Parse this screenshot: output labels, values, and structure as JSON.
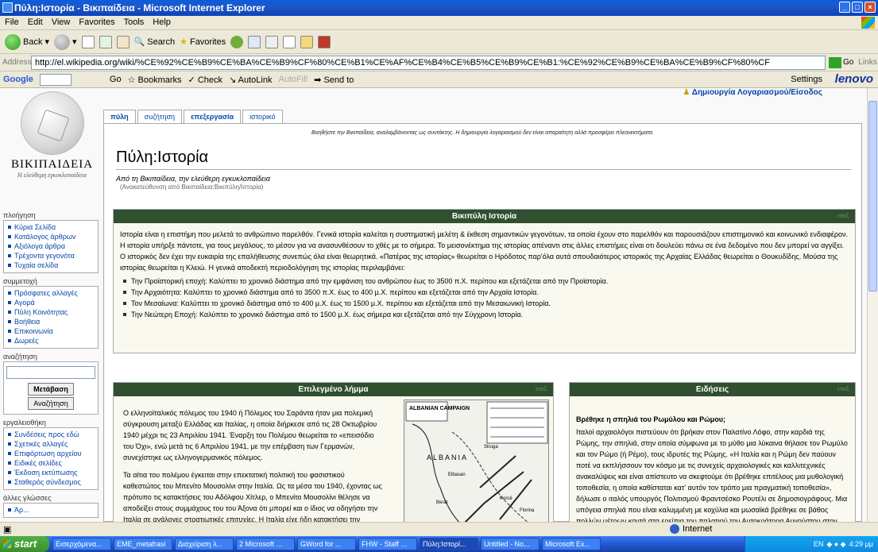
{
  "window": {
    "title": "Πύλη:Ιστορία - Βικιπαίδεια - Microsoft Internet Explorer"
  },
  "menu": [
    "File",
    "Edit",
    "View",
    "Favorites",
    "Tools",
    "Help"
  ],
  "toolbar": {
    "back": "Back",
    "search": "Search",
    "favorites": "Favorites"
  },
  "address": {
    "label": "Address",
    "url": "http://el.wikipedia.org/wiki/%CE%92%CE%B9%CE%BA%CE%B9%CF%80%CE%B1%CE%AF%CE%B4%CE%B5%CE%B9%CE%B1:%CE%92%CE%B9%CE%BA%CE%B9%CF%80%CF",
    "go": "Go",
    "links": "Links"
  },
  "googlebar": {
    "brand": "Google",
    "go": "Go",
    "bookmarks": "Bookmarks",
    "check": "Check",
    "autolink": "AutoLink",
    "autofill": "AutoFill",
    "sendto": "Send to",
    "settings": "Settings",
    "oem": "lenovo"
  },
  "wiki": {
    "logo_title": "ΒΙΚΙΠΑΙΔΕΙΑ",
    "logo_sub": "Η ελεύθερη εγκυκλοπαίδεια",
    "login": "Δημιουργία Λογαριασμού/Είσοδος",
    "tabs": [
      "πύλη",
      "συζήτηση",
      "επεξεργασία",
      "ιστορικό"
    ],
    "sitenotice": "Βοηθήστε την Βικιπαίδεια, αναλαμβάνοντας ως συντάκτης. Η δημιουργία λογαριασμού δεν είναι απαραίτητη αλλά προσφέρει πλεονεκτήματα.",
    "page_title": "Πύλη:Ιστορία",
    "tagline": "Από τη Βικιπαίδεια, την ελεύθερη εγκυκλοπαίδεια",
    "redirect": "(Ανακατεύθυνση από Βικιπαίδεια:Βικιπύλη/Ιστορία)",
    "panel1_title": "Βικιπύλη Ιστορία",
    "edit": "επεξ.",
    "panel1_text": "Ιστορία είναι η επιστήμη που μελετά το ανθρώπινο παρελθόν. Γενικά ιστορία καλείται η συστηματική μελέτη & έκθεση σημαντικών γεγονότων, τα οποία έχουν στο παρελθόν και παρουσιάζουν επιστημονικό και κοινωνικό ενδιαφέρον. Η ιστορία υπήρξε πάντοτε, για τους μεγάλους, το μέσον για να ανασυνθέσουν το χθές με το σήμερα. Το μεισονέκτημα της ιστορίας απέναντι στις άλλες επιστήμες είναι οτι δουλεύει πάνω σε ένα δεδομένο που δεν μπορεί να αγγίξει. Ο ιστορικός δεν έχει την ευκαιρία της επαλήθευσης συνεπώς όλα είναι θεωρητικά. «Πατέρας της ιστορίας» θεωρείται ο Ηρόδοτος παρ'όλα αυτά σπουδαιότερος ιστορικός της Αρχαίας Ελλάδας θεωρείται ο Θουκυδίδης. Μούσα της ιστορίας θεωρείται η Κλειώ. Η γενικά αποδεκτή περιοδολόγηση της ιστορίας περιλαμβάνει:",
    "periods": [
      "Την Προϊστορική εποχή: Καλύπτει το χρονικό διάστημα από την εμφάνιση του ανθρώπου έως το 3500 π.Χ. περίπου και εξετάζεται από την Προϊστορία.",
      "Την Αρχαιότητα: Καλύπτει το χρονικό διάστημα από το 3500 π.Χ. έως το 400 μ.Χ. περίπου και εξετάζεται από την Αρχαία Ιστορία.",
      "Τον Μεσαίωνα: Καλύπτει το χρονικό διάστημα από το 400 μ.Χ. έως το 1500 μ.Χ. περίπου και εξετάζεται από την Μεσαιωνική Ιστορία.",
      "Την Νεώτερη Εποχή: Καλύπτει το χρονικό διάστημα από το 1500 μ.Χ. έως σήμερα και εξετάζεται από την Σύγχρονη Ιστορία."
    ],
    "panel2_title": "Επιλεγμένο λήμμα",
    "panel2_p1": "Ο ελληνοϊταλικός πόλεμος του 1940 ή Πόλεμος του Σαράντα ήταν μια πολεμική σύγκρουση μεταξύ Ελλάδας και Ιταλίας, η οποία διήρκεσε από τις 28 Οκτωβρίου 1940 μέχρι τις 23 Απριλίου 1941. Έναρξη του Πολέμου θεωρείται το «επεισόδιο του Όχι», ενώ μετά τις 6 Απριλίου 1941, με την επέμβαση των Γερμανών, συνεχίστηκε ως ελληνογερμανικός πόλεμος.",
    "panel2_p2": "Τα αίτια του πολέμου έγκειται στην επεκτατική πολιτική του φασιστικού καθεστώτος του Μπενίτο Μουσολίνι στην Ιταλία. Ως τα μέσα του 1940, έχοντας ως πρότυπο τις κατακτήσεις του Αδόλφου Χίτλερ, ο Μπενίτο Μουσολίνι θέλησε να αποδείξει στους συμμάχους του του Άξονα ότι μπορεί και ο ίδιος να οδηγήσει την Ιταλία σε ανάλογες στρατιωτικές επιτυχίες. Η Ιταλία είχε ήδη κατακτήσει την Αλβανία από την άνοιξη του 1939, καθώς και πολλές βρετανικές βάσεις στην Αφρική, όπως τη Σομαλιλάνδη το καλοκαίρι του 1940, αλλά αυτές δεν ήταν επιτυχίες",
    "map_title": "ALBANIAN CAMPAIGN",
    "map_label": "ALBANIA",
    "map_places": [
      "Elbasan",
      "Korcë",
      "Berat",
      "Florina",
      "Struga"
    ],
    "panel3_title": "Ειδήσεις",
    "news_title": "Βρέθηκε η σπηλιά του Ρωμύλου και Ρώμου;",
    "news_text": "Ιταλοί αρχαιολόγοι πιστεύουν ότι βρήκαν στον Παλατίνο Λόφο, στην καρδιά της Ρώμης, την σπηλιά, στην οποία σύμφωνα με το μύθο μια λύκαινα θήλασε τον Ρωμύλο και τον Ρώμο (ή Ρέμο), τους ιδρυτές της Ρώμης. «Η Ιταλία και η Ρώμη δεν παύουν ποτέ να εκπλήσσουν τον κόσμο με τις συνεχείς αρχαιολογικές και καλλιτεχνικές ανακαλύψεις και είναι απίστευτο να σκεφτούμε ότι βρέθηκε επιτέλους μια μυθολογική τοποθεσία, η οποία καθίσταται κατ' αυτόν τον τρόπο μια πραγματική τοποθεσία», δήλωσε ο ιταλός υπουργός Πολιτισμού Φραντσέσκο Ρουτέλι σε δημοσιογράφους. Μια υπόγεια σπηλιά που είναι καλυμμένη με κοχύλια και μωσαϊκά βρέθηκε σε βάθος πολλών μέτρων κοντά στα ερείπια του παλατιού του Αυτοκράτορα Αυγούστου στον Παλατίνο Λόφο. Η σπηλιά, η οποία βρέθηκε στη διάρκεια εργασιών αποκατάστασης, έχει διάμετρο 6,5 μέτρων και ύψος 7 μέτρων. Σύμφωνα με το",
    "sidebar": {
      "nav_h": "πλοήγηση",
      "nav": [
        "Κύρια Σελίδα",
        "Κατάλογος άρθρων",
        "Αξιόλογα άρθρα",
        "Τρέχοντα γεγονότα",
        "Τυχαία σελίδα"
      ],
      "comm_h": "συμμετοχή",
      "comm": [
        "Πρόσφατες αλλαγές",
        "Αγορά",
        "Πύλη Κοινότητας",
        "Βοήθεια",
        "Επικοινωνία",
        "Δωρεές"
      ],
      "search_h": "αναζήτηση",
      "go": "Μετάβαση",
      "search": "Αναζήτηση",
      "tools_h": "εργαλειοθήκη",
      "tools": [
        "Συνδέσεις προς εδώ",
        "Σχετικές αλλαγές",
        "Επιφόρτωση αρχείου",
        "Ειδικές σελίδες",
        "Έκδοση εκτύπωσης",
        "Σταθερός σύνδεσμος"
      ],
      "lang_h": "άλλες γλώσσες",
      "lang": [
        "Ἀρ..."
      ]
    }
  },
  "status": {
    "zone": "Internet"
  },
  "taskbar": {
    "start": "start",
    "tasks": [
      "Εισερχόμενα...",
      "EME_metafrasi",
      "Διαχείριση λ...",
      "2 Microsoft ...",
      "GWord for ...",
      "FHW - Staff ...",
      "Πύλη:Ιστορί...",
      "Untitled - No...",
      "Microsoft Ex..."
    ],
    "lang": "EN",
    "clock": "4:29 μμ"
  }
}
